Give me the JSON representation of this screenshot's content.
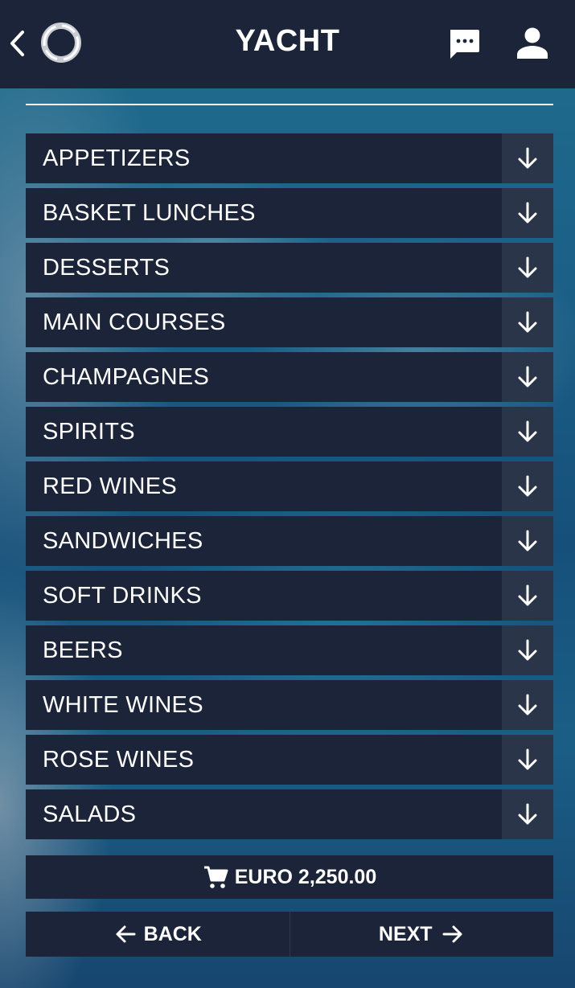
{
  "header": {
    "title": "YACHT",
    "back_icon": "chevron-left-icon",
    "logo": "ring-logo",
    "chat_icon": "chat-bubble-icon",
    "user_icon": "user-icon"
  },
  "menu": {
    "items": [
      {
        "label": "APPETIZERS",
        "icon": "arrow-down-icon"
      },
      {
        "label": "BASKET LUNCHES",
        "icon": "arrow-down-icon"
      },
      {
        "label": "DESSERTS",
        "icon": "arrow-down-icon"
      },
      {
        "label": "MAIN COURSES",
        "icon": "arrow-down-icon"
      },
      {
        "label": "CHAMPAGNES",
        "icon": "arrow-down-icon"
      },
      {
        "label": "SPIRITS",
        "icon": "arrow-down-icon"
      },
      {
        "label": "RED WINES",
        "icon": "arrow-down-icon"
      },
      {
        "label": "SANDWICHES",
        "icon": "arrow-down-icon"
      },
      {
        "label": "SOFT DRINKS",
        "icon": "arrow-down-icon"
      },
      {
        "label": "BEERS",
        "icon": "arrow-down-icon"
      },
      {
        "label": "WHITE WINES",
        "icon": "arrow-down-icon"
      },
      {
        "label": "ROSE WINES",
        "icon": "arrow-down-icon"
      },
      {
        "label": "SALADS",
        "icon": "arrow-down-icon"
      }
    ]
  },
  "cart": {
    "icon": "cart-icon",
    "total": "EURO 2,250.00"
  },
  "navigation": {
    "back_label": "BACK",
    "next_label": "NEXT"
  },
  "colors": {
    "panel": "#1b2438",
    "toggle": "#2a3549",
    "text": "#ffffff"
  }
}
